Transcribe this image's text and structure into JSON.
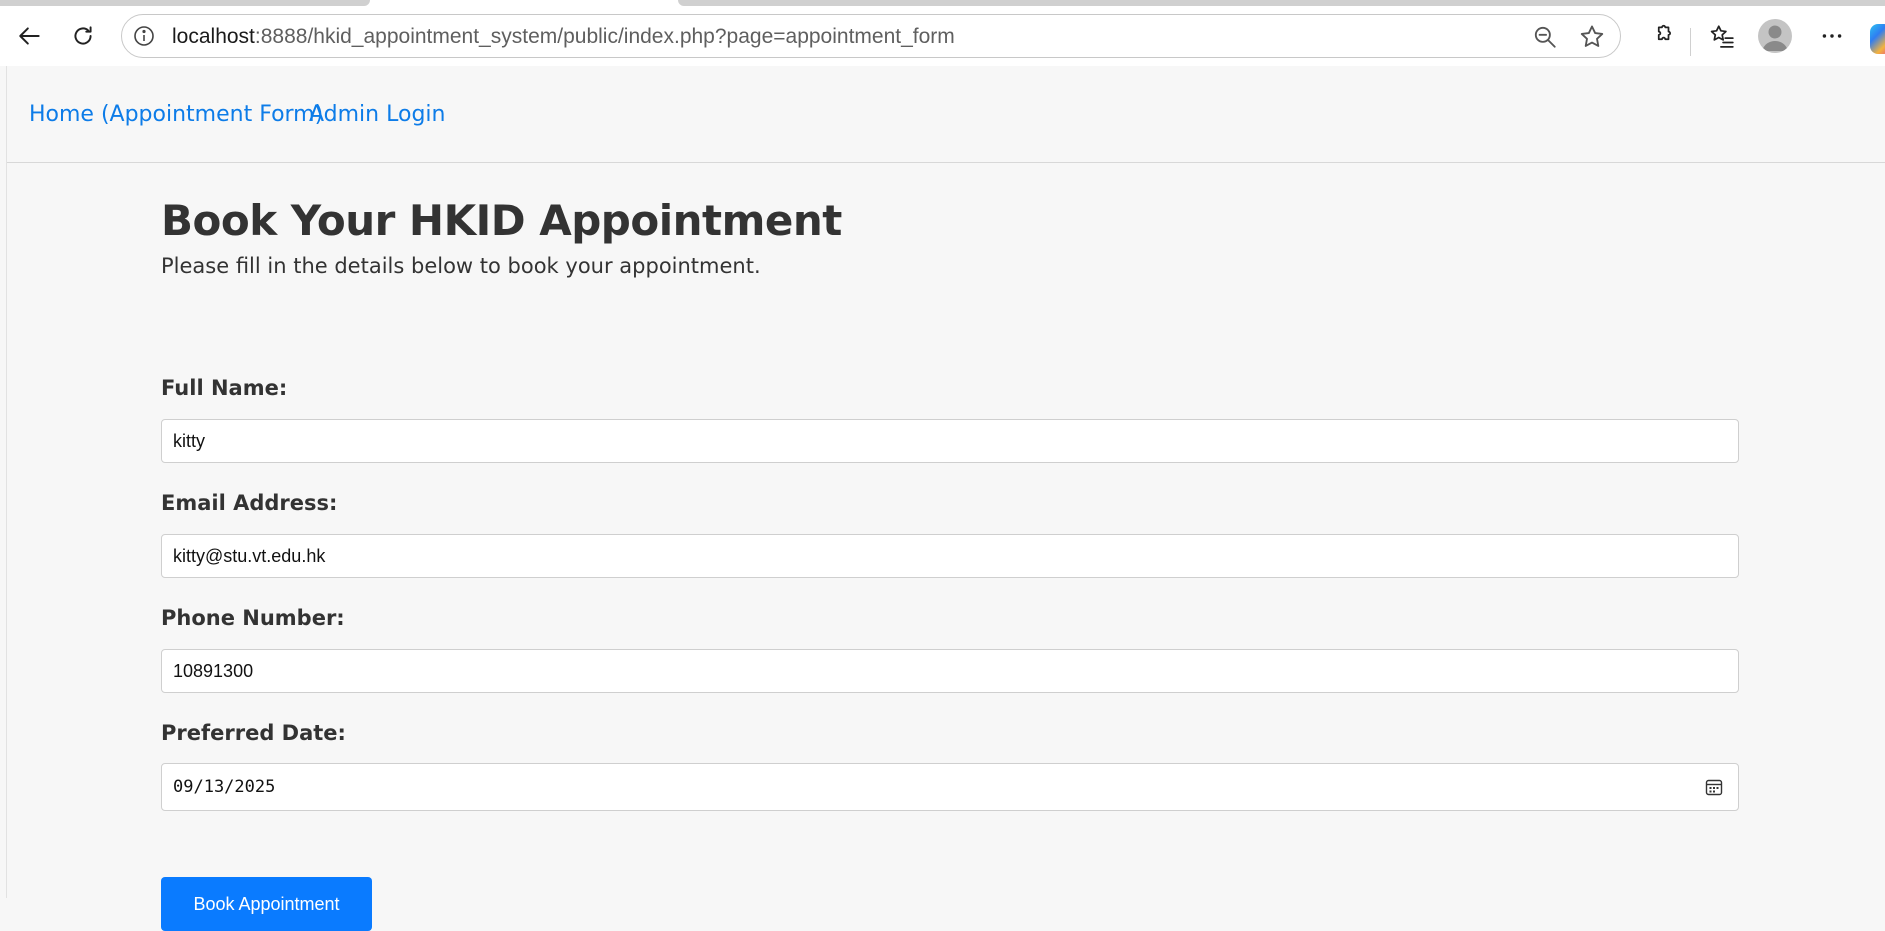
{
  "browser": {
    "url_host": "localhost",
    "url_rest": ":8888/hkid_appointment_system/public/index.php?page=appointment_form",
    "icons": [
      "back-icon",
      "refresh-icon",
      "site-info-icon",
      "zoom-out-icon",
      "favorite-star-icon",
      "extensions-icon",
      "favorites-icon",
      "profile-avatar-icon",
      "more-options-icon",
      "copilot-icon"
    ]
  },
  "nav": {
    "home_label": "Home (Appointment Form)",
    "admin_label": "Admin Login",
    "link_color": "#0d7ce8"
  },
  "form": {
    "title": "Book Your HKID Appointment",
    "subtitle": "Please fill in the details below to book your appointment.",
    "full_name_label": "Full Name:",
    "full_name_value": "kitty",
    "email_label": "Email Address:",
    "email_value": "kitty@stu.vt.edu.hk",
    "phone_label": "Phone Number:",
    "phone_value": "10891300",
    "date_label": "Preferred Date:",
    "date_value": "09/13/2025",
    "submit_label": "Book Appointment",
    "submit_color": "#0a7bff"
  }
}
